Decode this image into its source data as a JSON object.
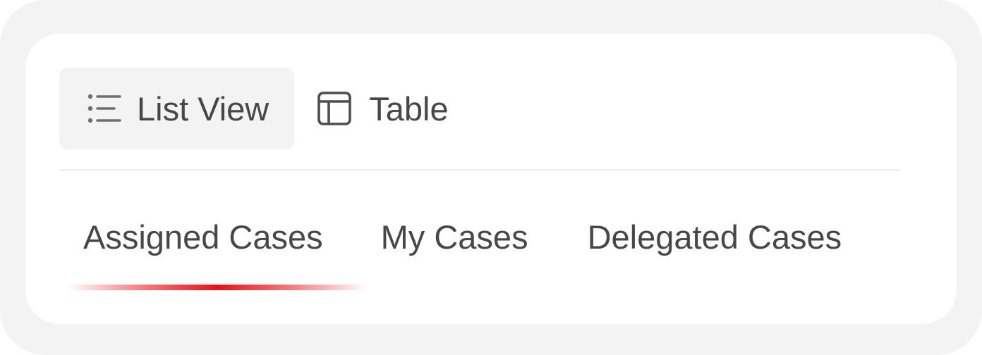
{
  "view_toggle": {
    "list_label": "List View",
    "list_icon": "list-icon",
    "table_label": "Table",
    "table_icon": "table-icon",
    "active": "List View"
  },
  "tabs": {
    "items": [
      {
        "label": "Assigned Cases"
      },
      {
        "label": "My Cases"
      },
      {
        "label": "Delegated Cases"
      }
    ],
    "active": "Assigned Cases"
  },
  "colors": {
    "accent": "#e8111a",
    "text": "#474747",
    "frame": "#f3f3f3",
    "card": "#ffffff"
  }
}
